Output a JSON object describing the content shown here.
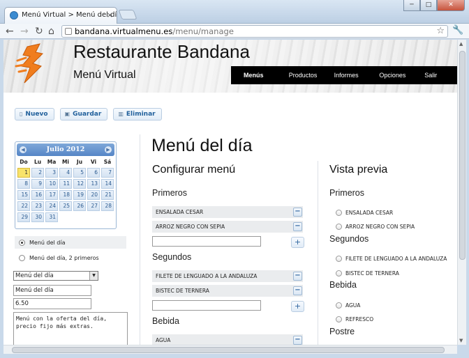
{
  "browser": {
    "tab_title": "Menú Virtual > Menú del dí",
    "url_host": "bandana.virtualmenu.es",
    "url_path": "/menu/manage"
  },
  "header": {
    "title": "Restaurante Bandana",
    "subtitle": "Menú Virtual",
    "nav": [
      "Menús",
      "Productos",
      "Informes",
      "Opciones",
      "Salir"
    ]
  },
  "actions": {
    "nuevo": "Nuevo",
    "guardar": "Guardar",
    "eliminar": "Eliminar"
  },
  "calendar": {
    "month": "Julio 2012",
    "weekdays": [
      "Do",
      "Lu",
      "Ma",
      "Mi",
      "Ju",
      "Vi",
      "Sá"
    ],
    "days": [
      "1",
      "2",
      "3",
      "4",
      "5",
      "6",
      "7",
      "8",
      "9",
      "10",
      "11",
      "12",
      "13",
      "14",
      "15",
      "16",
      "17",
      "18",
      "19",
      "20",
      "21",
      "22",
      "23",
      "24",
      "25",
      "26",
      "27",
      "28",
      "29",
      "30",
      "31"
    ],
    "today": "1"
  },
  "menus": {
    "options": [
      "Menú del día",
      "Menú del día, 2 primeros"
    ],
    "selected_index": 0
  },
  "form": {
    "select_value": "Menú del día",
    "name_value": "Menú del día",
    "price_value": "6.50",
    "description": "Menú con la oferta del día, precio fijo más extras."
  },
  "content": {
    "page_title": "Menú del día",
    "config_title": "Configurar menú",
    "preview_title": "Vista previa",
    "groups": [
      {
        "name": "Primeros",
        "items": [
          "ENSALADA CESAR",
          "ARROZ NEGRO CON SEPIA"
        ]
      },
      {
        "name": "Segundos",
        "items": [
          "FILETE DE LENGUADO A LA ANDALUZA",
          "BISTEC DE TERNERA"
        ]
      },
      {
        "name": "Bebida",
        "items": [
          "AGUA",
          "REFRESCO"
        ]
      },
      {
        "name": "Postre",
        "items": []
      }
    ]
  },
  "icons": {
    "minus": "−",
    "plus": "+"
  }
}
